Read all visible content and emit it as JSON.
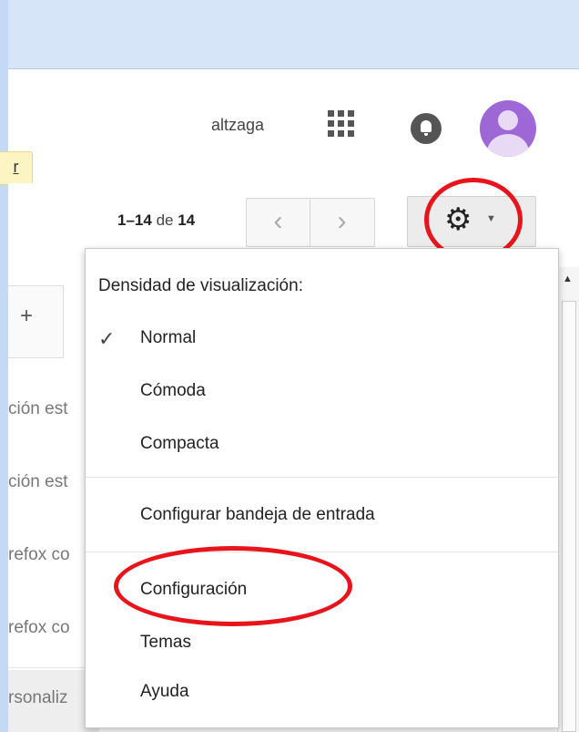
{
  "header": {
    "username": "altzaga",
    "icons": {
      "apps": "apps-grid-icon",
      "notifications": "bell-icon",
      "avatar": "user-avatar"
    }
  },
  "notice": {
    "text": "r"
  },
  "pager": {
    "range": "1–14",
    "of": "de",
    "total": "14"
  },
  "nav": {
    "prev": "‹",
    "next": "›"
  },
  "settings": {
    "gear": "⚙",
    "caret": "▼"
  },
  "tabs": {
    "add": "+"
  },
  "list": {
    "rows": [
      "ción est",
      "ción est",
      "refox co",
      "refox co"
    ],
    "bottom": "rsonaliz"
  },
  "menu": {
    "heading": "Densidad de visualización:",
    "density": [
      "Normal",
      "Cómoda",
      "Compacta"
    ],
    "selected_density": "Normal",
    "inbox": "Configurar bandeja de entrada",
    "settings": "Configuración",
    "themes": "Temas",
    "help": "Ayuda",
    "check": "✓"
  },
  "colors": {
    "highlight": "#e8141c",
    "avatar": "#9e67d6",
    "frame": "#c4d9f5"
  }
}
